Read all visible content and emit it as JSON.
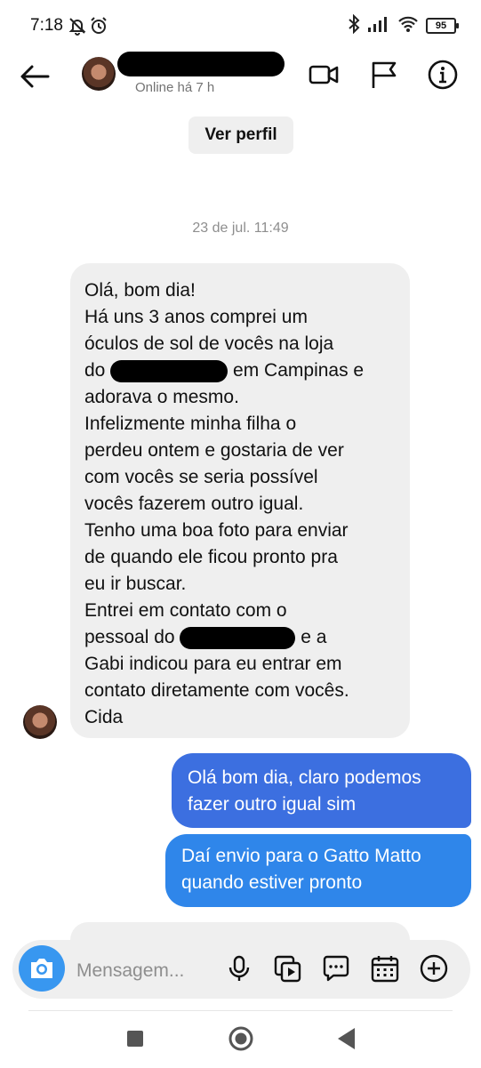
{
  "status_bar": {
    "time": "7:18",
    "battery": "95",
    "icons": [
      "do-not-disturb-icon",
      "alarm-icon",
      "bluetooth-icon",
      "signal-icon",
      "wifi-icon",
      "battery-icon"
    ]
  },
  "header": {
    "online_status": "Online há 7 h",
    "icons": [
      "back-arrow-icon",
      "video-call-icon",
      "flag-icon",
      "info-icon"
    ]
  },
  "profile_button": "Ver perfil",
  "timestamp": "23 de jul. 11:49",
  "incoming_message": {
    "line1": "Olá, bom dia!",
    "line2": "Há uns 3 anos comprei um",
    "line3": "óculos de sol de vocês na loja",
    "line4_pre": "do",
    "line4_post": "em Campinas e",
    "line5": "adorava o mesmo.",
    "line6": "Infelizmente minha filha o",
    "line7": "perdeu ontem e gostaria de ver",
    "line8": "com vocês se seria possível",
    "line9": "vocês fazerem outro igual.",
    "line10": "Tenho uma boa foto para enviar",
    "line11": "de quando ele ficou pronto pra",
    "line12": "eu ir buscar.",
    "line13": "Entrei em contato com o",
    "line14_pre": "pessoal do",
    "line14_post": "e a",
    "line15": "Gabi indicou para eu entrar em",
    "line16": "contato diretamente com vocês.",
    "line17": "Cida"
  },
  "outgoing_messages": [
    {
      "line1": "Olá bom dia, claro podemos",
      "line2": "fazer outro igual sim"
    },
    {
      "line1": "Daí envio para o Gatto Matto",
      "line2": "quando estiver pronto"
    }
  ],
  "composer": {
    "placeholder": "Mensagem...",
    "icons": [
      "camera-icon",
      "microphone-icon",
      "gallery-icon",
      "chat-bubble-icon",
      "calendar-icon",
      "add-icon"
    ]
  },
  "nav_bar": {
    "icons": [
      "recents-icon",
      "home-icon",
      "back-icon"
    ]
  },
  "colors": {
    "outgoing_bubble": "#3a79e3",
    "incoming_bubble": "#efefef",
    "camera_button": "#3897f0"
  }
}
